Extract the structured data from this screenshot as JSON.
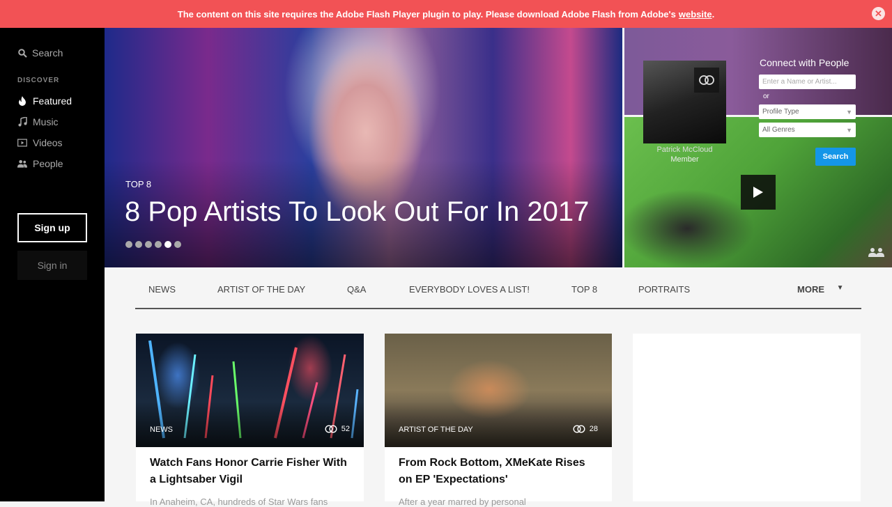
{
  "banner": {
    "message": "The content on this site requires the Adobe Flash Player plugin to play. Please download Adobe Flash from Adobe's",
    "link_text": "website",
    "trailing": ".",
    "close_icon": "close-icon"
  },
  "sidebar": {
    "search_label": "Search",
    "discover_heading": "DISCOVER",
    "items": [
      {
        "label": "Featured",
        "icon": "flame-icon",
        "active": true
      },
      {
        "label": "Music",
        "icon": "music-note-icon",
        "active": false
      },
      {
        "label": "Videos",
        "icon": "video-icon",
        "active": false
      },
      {
        "label": "People",
        "icon": "people-icon",
        "active": false
      }
    ],
    "signup_label": "Sign up",
    "signin_label": "Sign in"
  },
  "hero": {
    "tag": "TOP 8",
    "title": "8 Pop Artists To Look Out For In 2017",
    "slide_count": 6,
    "active_slide": 5
  },
  "connect": {
    "title": "Connect with People",
    "name_placeholder": "Enter a Name or Artist...",
    "or_label": "or",
    "profile_type": "Profile Type",
    "genres": "All Genres",
    "search_label": "Search",
    "profile_name": "Patrick McCloud",
    "profile_role": "Member"
  },
  "tabs": [
    "NEWS",
    "ARTIST OF THE DAY",
    "Q&A",
    "EVERYBODY LOVES A LIST!",
    "TOP 8",
    "PORTRAITS"
  ],
  "more_label": "MORE",
  "cards": [
    {
      "category": "NEWS",
      "count": "52",
      "title": "Watch Fans Honor Carrie Fisher With a Lightsaber Vigil",
      "excerpt": "In Anaheim, CA, hundreds of Star Wars fans"
    },
    {
      "category": "ARTIST OF THE DAY",
      "count": "28",
      "title": "From Rock Bottom, XMeKate Rises on EP 'Expectations'",
      "excerpt": "After a year marred by personal"
    }
  ],
  "colors": {
    "banner": "#f25255",
    "accent_blue": "#1496e8",
    "sidebar": "#000000"
  }
}
